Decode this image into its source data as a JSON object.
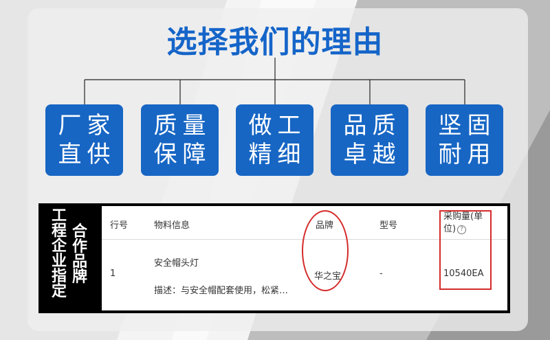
{
  "heading": "选择我们的理由",
  "reasons": [
    {
      "line1": "厂家",
      "line2": "直供"
    },
    {
      "line1": "质量",
      "line2": "保障"
    },
    {
      "line1": "做工",
      "line2": "精细"
    },
    {
      "line1": "品质",
      "line2": "卓越"
    },
    {
      "line1": "坚固",
      "line2": "耐用"
    }
  ],
  "side_label": {
    "col1": [
      "工",
      "程",
      "企",
      "业",
      "指",
      "定"
    ],
    "col2": [
      "合",
      "作",
      "品",
      "牌"
    ]
  },
  "table": {
    "headers": {
      "row_no": "行号",
      "material": "物料信息",
      "brand": "品牌",
      "model": "型号",
      "qty_line1": "采购量(单",
      "qty_line2": "位)"
    },
    "row": {
      "row_no": "1",
      "material_name": "安全帽头灯",
      "material_desc": "描述：与安全帽配套使用，松紧…",
      "brand": "华之宝",
      "model": "-",
      "qty": "10540EA"
    }
  },
  "colors": {
    "accent_blue": "#1766c4",
    "title_blue": "#1565c9",
    "highlight_red": "#d42a2a"
  },
  "icons": [
    "help-circle-icon"
  ]
}
